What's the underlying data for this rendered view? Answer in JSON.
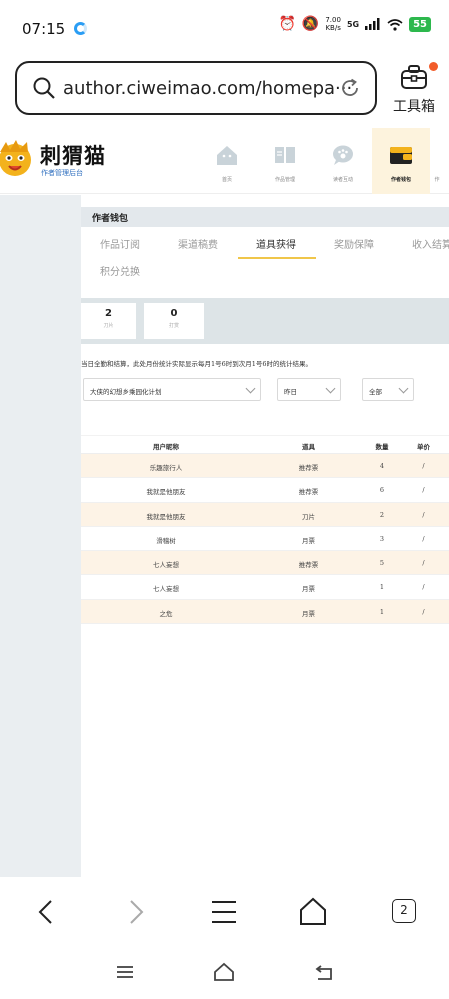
{
  "status": {
    "time": "07:15",
    "netspeed_value": "7.00",
    "netspeed_unit": "KB/s",
    "signal_label": "5G",
    "battery": "55"
  },
  "browser": {
    "url": "author.ciweimao.com/homepa···",
    "toolbox_label": "工具箱",
    "tab_count": "2"
  },
  "site": {
    "logo_title": "刺猬猫",
    "logo_subtitle": "作者管理后台",
    "nav": [
      {
        "label": "首页",
        "icon": "house-icon"
      },
      {
        "label": "作品管理",
        "icon": "book-icon"
      },
      {
        "label": "读者互动",
        "icon": "chat-paw-icon"
      },
      {
        "label": "作者钱包",
        "icon": "wallet-icon"
      },
      {
        "label": "作",
        "icon": "partial-icon"
      }
    ]
  },
  "wallet": {
    "title": "作者钱包",
    "tabs": [
      "作品订阅",
      "渠道稿费",
      "道具获得",
      "奖励保障",
      "收入结算",
      "积分兑换"
    ],
    "active_tab": "道具获得",
    "stats": [
      {
        "value": "2",
        "label": "刀片"
      },
      {
        "value": "0",
        "label": "打赏"
      }
    ],
    "notice": "当日全勤和结算，此处月份统计实际显示每月1号6时到次月1号6时的统计结果。",
    "filters": {
      "book": "大侠的幻想乡乘园化计划",
      "date": "昨日",
      "type": "全部"
    },
    "table": {
      "headers": [
        "用户昵称",
        "道具",
        "数量",
        "单价"
      ],
      "rows": [
        [
          "乐趣旅行人",
          "推荐票",
          "4",
          "/"
        ],
        [
          "我就是他朋友",
          "推荐票",
          "6",
          "/"
        ],
        [
          "我就是他朋友",
          "刀片",
          "2",
          "/"
        ],
        [
          "滑稽树",
          "月票",
          "3",
          "/"
        ],
        [
          "七人妄想",
          "推荐票",
          "5",
          "/"
        ],
        [
          "七人妄想",
          "月票",
          "1",
          "/"
        ],
        [
          "之危",
          "月票",
          "1",
          "/"
        ]
      ]
    }
  },
  "colors": {
    "accent": "#f0c64a",
    "active_nav_bg": "#fdf3dd",
    "row_highlight": "#fdf3e6",
    "sidebar_bg": "#eaeef1"
  }
}
